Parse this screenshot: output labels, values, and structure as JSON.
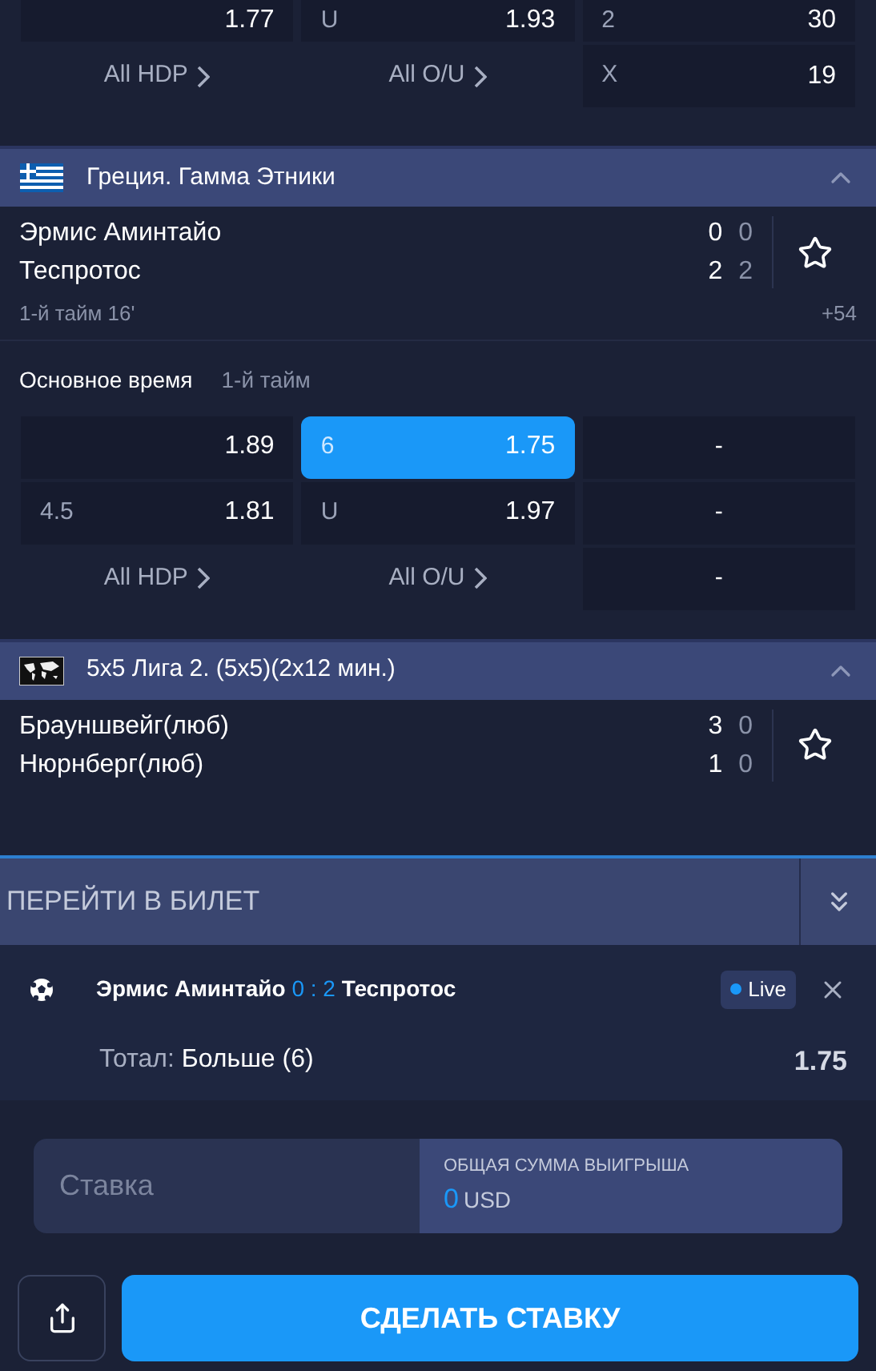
{
  "top_market": {
    "rows": [
      [
        {
          "kind": "odd",
          "value": "1.77",
          "selected": false
        },
        {
          "kind": "odd",
          "label": "U",
          "value": "1.93",
          "selected": false
        },
        {
          "kind": "odd",
          "label": "2",
          "value": "30",
          "selected": false
        }
      ],
      [
        {
          "kind": "link",
          "label": "All HDP"
        },
        {
          "kind": "link",
          "label": "All O/U"
        },
        {
          "kind": "odd",
          "label": "X",
          "value": "19",
          "selected": false
        }
      ]
    ]
  },
  "leagues": [
    {
      "flag": {
        "kind": "greece"
      },
      "title": "Греция. Гамма Этники",
      "expanded": true,
      "match": {
        "teams": [
          {
            "name": "Эрмис Аминтайо",
            "score": "0",
            "score_2": "0"
          },
          {
            "name": "Теспротос",
            "score": "2",
            "score_2": "2"
          }
        ],
        "favorite": false,
        "period": "1-й тайм 16'",
        "more": "+54"
      },
      "market_tabs": [
        {
          "label": "Основное время",
          "selected": true
        },
        {
          "label": "1-й тайм",
          "selected": false
        }
      ],
      "rows": [
        [
          {
            "kind": "odd",
            "value": "1.89",
            "selected": false
          },
          {
            "kind": "odd",
            "label": "6",
            "value": "1.75",
            "selected": true
          },
          {
            "kind": "dash",
            "value": "-"
          }
        ],
        [
          {
            "kind": "odd",
            "label": "4.5",
            "value": "1.81",
            "selected": false
          },
          {
            "kind": "odd",
            "label": "U",
            "value": "1.97",
            "selected": false
          },
          {
            "kind": "dash",
            "value": "-"
          }
        ],
        [
          {
            "kind": "link",
            "label": "All HDP"
          },
          {
            "kind": "link",
            "label": "All O/U"
          },
          {
            "kind": "dash",
            "value": "-"
          }
        ]
      ]
    },
    {
      "flag": {
        "kind": "world"
      },
      "title": "5x5 Лига 2. (5x5)(2x12 мин.)",
      "expanded": true,
      "match": {
        "teams": [
          {
            "name": "Брауншвейг(люб)",
            "score": "3",
            "score_2": "0"
          },
          {
            "name": "Нюрнберг(люб)",
            "score": "1",
            "score_2": "0"
          }
        ],
        "favorite": false
      }
    }
  ],
  "bet_slip": {
    "title": "ПЕРЕЙТИ В БИЛЕТ",
    "bet": {
      "home": "Эрмис Аминтайо",
      "home_score": "0",
      "separator": ":",
      "away_score": "2",
      "away": "Теспротос",
      "live": "Live",
      "market": "Тотал:",
      "selection": "Больше (6)",
      "odds": "1.75"
    },
    "stake": {
      "placeholder": "Ставка",
      "payout_label": "ОБЩАЯ СУММА ВЫИГРЫША",
      "payout_value": "0",
      "currency": "USD"
    },
    "submit": "СДЕЛАТЬ СТАВКУ"
  }
}
